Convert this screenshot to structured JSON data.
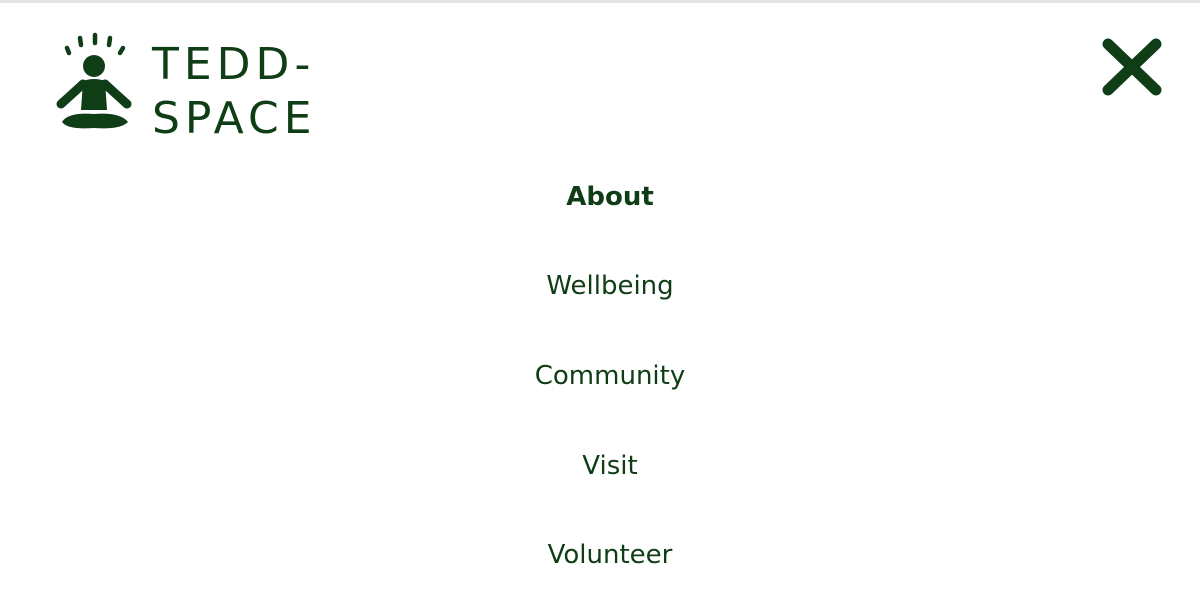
{
  "brand": {
    "line1": "TEDD-",
    "line2": "SPACE",
    "logo_icon": "meditating-person-icon",
    "color": "#0f3d16"
  },
  "close": {
    "icon": "close-icon"
  },
  "menu": {
    "items": [
      {
        "label": "About",
        "active": true
      },
      {
        "label": "Wellbeing",
        "active": false
      },
      {
        "label": "Community",
        "active": false
      },
      {
        "label": "Visit",
        "active": false
      },
      {
        "label": "Volunteer",
        "active": false
      }
    ]
  }
}
